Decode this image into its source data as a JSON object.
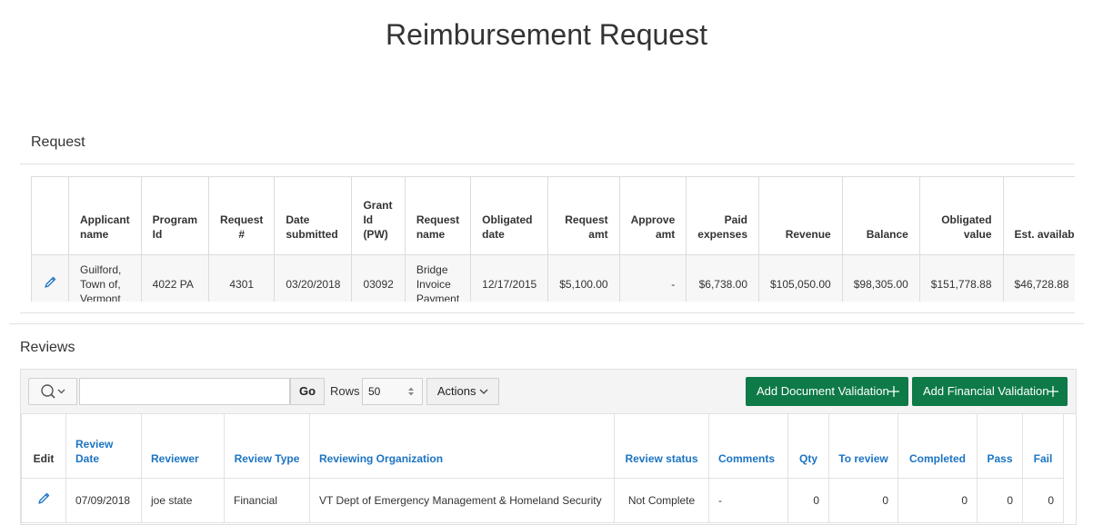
{
  "page_title": "Reimbursement Request",
  "request": {
    "section_title": "Request",
    "columns": [
      "",
      "Applicant name",
      "Program Id",
      "Request #",
      "Date submitted",
      "Grant Id (PW)",
      "Request name",
      "Obligated date",
      "Request amt",
      "Approve amt",
      "Paid expenses",
      "Revenue",
      "Balance",
      "Obligated value",
      "Est. available"
    ],
    "row": {
      "applicant_name": "Guilford, Town of, Vermont",
      "program_id": "4022 PA",
      "request_num": "4301",
      "date_submitted": "03/20/2018",
      "grant_id": "03092",
      "request_name": "Bridge Invoice Payment",
      "obligated_date": "12/17/2015",
      "request_amt": "$5,100.00",
      "approve_amt": "-",
      "paid_expenses": "$6,738.00",
      "revenue": "$105,050.00",
      "balance": "$98,305.00",
      "obligated_value": "$151,778.88",
      "est_available": "$46,728.88"
    }
  },
  "reviews": {
    "section_title": "Reviews",
    "toolbar": {
      "search_placeholder": "",
      "go_label": "Go",
      "rows_label": "Rows",
      "rows_value": "50",
      "actions_label": "Actions",
      "add_doc_label": "Add Document Validation",
      "add_fin_label": "Add Financial Validation"
    },
    "columns": [
      "Edit",
      "Review Date",
      "Reviewer",
      "Review Type",
      "Reviewing Organization",
      "Review status",
      "Comments",
      "Qty",
      "To review",
      "Completed",
      "Pass",
      "Fail"
    ],
    "row": {
      "review_date": "07/09/2018",
      "reviewer": "joe state",
      "review_type": "Financial",
      "organization": "VT Dept of Emergency Management & Homeland Security",
      "status": "Not Complete",
      "comments": "-",
      "qty": "0",
      "to_review": "0",
      "completed": "0",
      "pass": "0",
      "fail": "0"
    }
  },
  "colors": {
    "accent_green": "#0e7a47",
    "link_blue": "#1c74c2"
  }
}
